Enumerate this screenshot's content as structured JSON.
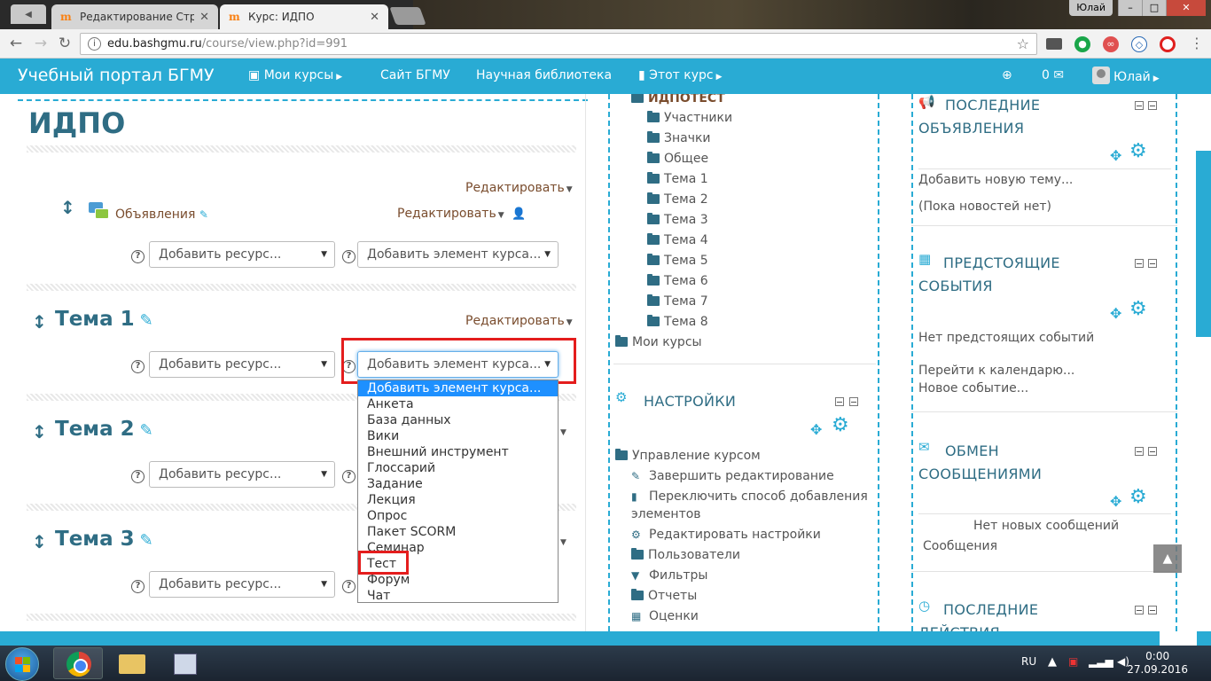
{
  "browser": {
    "tabs": [
      {
        "title": "Редактирование Стран",
        "active": false
      },
      {
        "title": "Курс: ИДПО",
        "active": true
      }
    ],
    "window_user": "Юлай",
    "url_host": "edu.bashgmu.ru",
    "url_path": "/course/view.php?id=991"
  },
  "navbar": {
    "brand": "Учебный портал БГМУ",
    "my_courses": "Мои курсы",
    "site": "Сайт БГМУ",
    "library": "Научная библиотека",
    "this_course": "Этот курс",
    "messages_count": "0",
    "user": "Юлай"
  },
  "course": {
    "title": "ИДПО",
    "edit_label": "Редактировать",
    "announcements": "Объявления",
    "add_resource": "Добавить ресурс...",
    "add_activity": "Добавить элемент курса...",
    "sections": [
      "Тема 1",
      "Тема 2",
      "Тема 3"
    ]
  },
  "dropdown": {
    "options": [
      "Добавить элемент курса...",
      "Анкета",
      "База данных",
      "Вики",
      "Внешний инструмент",
      "Глоссарий",
      "Задание",
      "Лекция",
      "Опрос",
      "Пакет SCORM",
      "Семинар",
      "Тест",
      "Форум",
      "Чат"
    ],
    "selected": "Добавить элемент курса...",
    "highlighted": "Тест"
  },
  "navigation": {
    "course_short": "ИДПОТЕСТ",
    "items": [
      "Участники",
      "Значки",
      "Общее",
      "Тема 1",
      "Тема 2",
      "Тема 3",
      "Тема 4",
      "Тема 5",
      "Тема 6",
      "Тема 7",
      "Тема 8"
    ],
    "my_courses": "Мои курсы"
  },
  "settings": {
    "title": "НАСТРОЙКИ",
    "course_admin": "Управление курсом",
    "items": [
      "Завершить редактирование",
      "Переключить способ добавления",
      "элементов",
      "Редактировать настройки",
      "Пользователи",
      "Фильтры",
      "Отчеты",
      "Оценки"
    ]
  },
  "blocks": {
    "news": {
      "title_1": "ПОСЛЕДНИЕ",
      "title_2": "ОБЪЯВЛЕНИЯ",
      "add": "Добавить новую тему...",
      "empty": "(Пока новостей нет)"
    },
    "events": {
      "title_1": "ПРЕДСТОЯЩИЕ",
      "title_2": "СОБЫТИЯ",
      "empty": "Нет предстоящих событий",
      "calendar": "Перейти к календарю...",
      "new_event": "Новое событие..."
    },
    "messages": {
      "title_1": "ОБМЕН",
      "title_2": "СООБЩЕНИЯМИ",
      "empty": "Нет новых сообщений",
      "link": "Сообщения"
    },
    "recent": {
      "title_1": "ПОСЛЕДНИЕ",
      "title_2": "ДЕЙСТВИЯ"
    }
  },
  "taskbar": {
    "lang": "RU",
    "time": "0:00",
    "date": "27.09.2016"
  },
  "colors": {
    "accent": "#29abd4",
    "heading": "#2f6d84",
    "highlight_box": "#e41d1d",
    "selected_option": "#1e90ff"
  }
}
